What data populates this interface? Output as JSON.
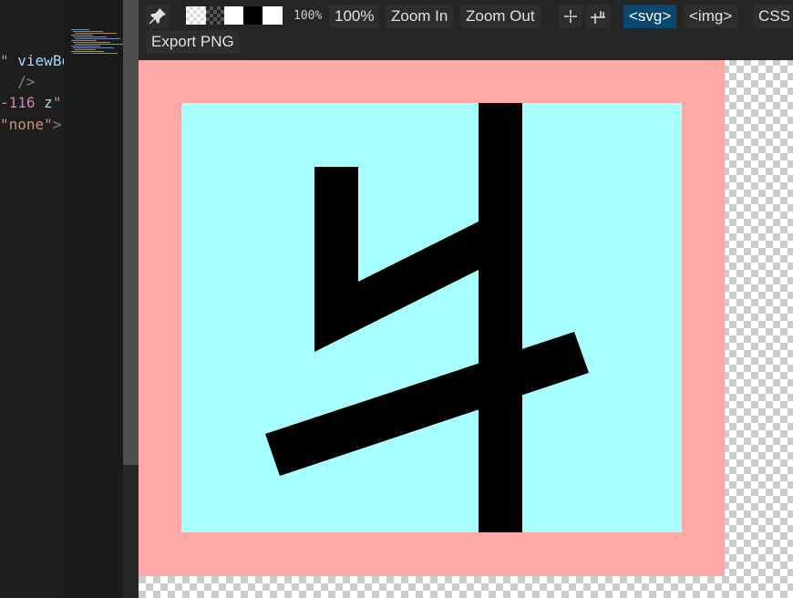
{
  "editor": {
    "lines": [
      {
        "parts": [
          {
            "cls": "tok-str",
            "text": "\""
          },
          {
            "cls": "tok-plain",
            "text": " "
          },
          {
            "cls": "tok-attr",
            "text": "viewBo"
          }
        ]
      },
      {
        "parts": [
          {
            "cls": "tok-plain",
            "text": "  "
          },
          {
            "cls": "tok-punc",
            "text": "/>"
          }
        ]
      },
      {
        "parts": [
          {
            "cls": "tok-num",
            "text": "-116"
          },
          {
            "cls": "tok-plain",
            "text": " "
          },
          {
            "cls": "tok-attr",
            "text": "z"
          },
          {
            "cls": "tok-str",
            "text": "\""
          }
        ]
      },
      {
        "parts": [
          {
            "cls": "tok-str",
            "text": "\"none\""
          },
          {
            "cls": "tok-punc",
            "text": ">"
          }
        ]
      }
    ]
  },
  "toolbar": {
    "zoom_readout": "100%",
    "zoom_100_label": "100%",
    "zoom_in_label": "Zoom In",
    "zoom_out_label": "Zoom Out",
    "svg_tab_label": "<svg>",
    "img_tab_label": "<img>",
    "css_tab_label": "CSS",
    "export_png_label": "Export PNG",
    "swatches": [
      "#ffffff",
      "#333333",
      "#ffffff",
      "#000000",
      "#ffffff"
    ]
  },
  "colors": {
    "outer_frame": "#ffa8a8",
    "inner_fill": "#a8ffff",
    "glyph": "#000000",
    "active_tab": "#094771"
  }
}
